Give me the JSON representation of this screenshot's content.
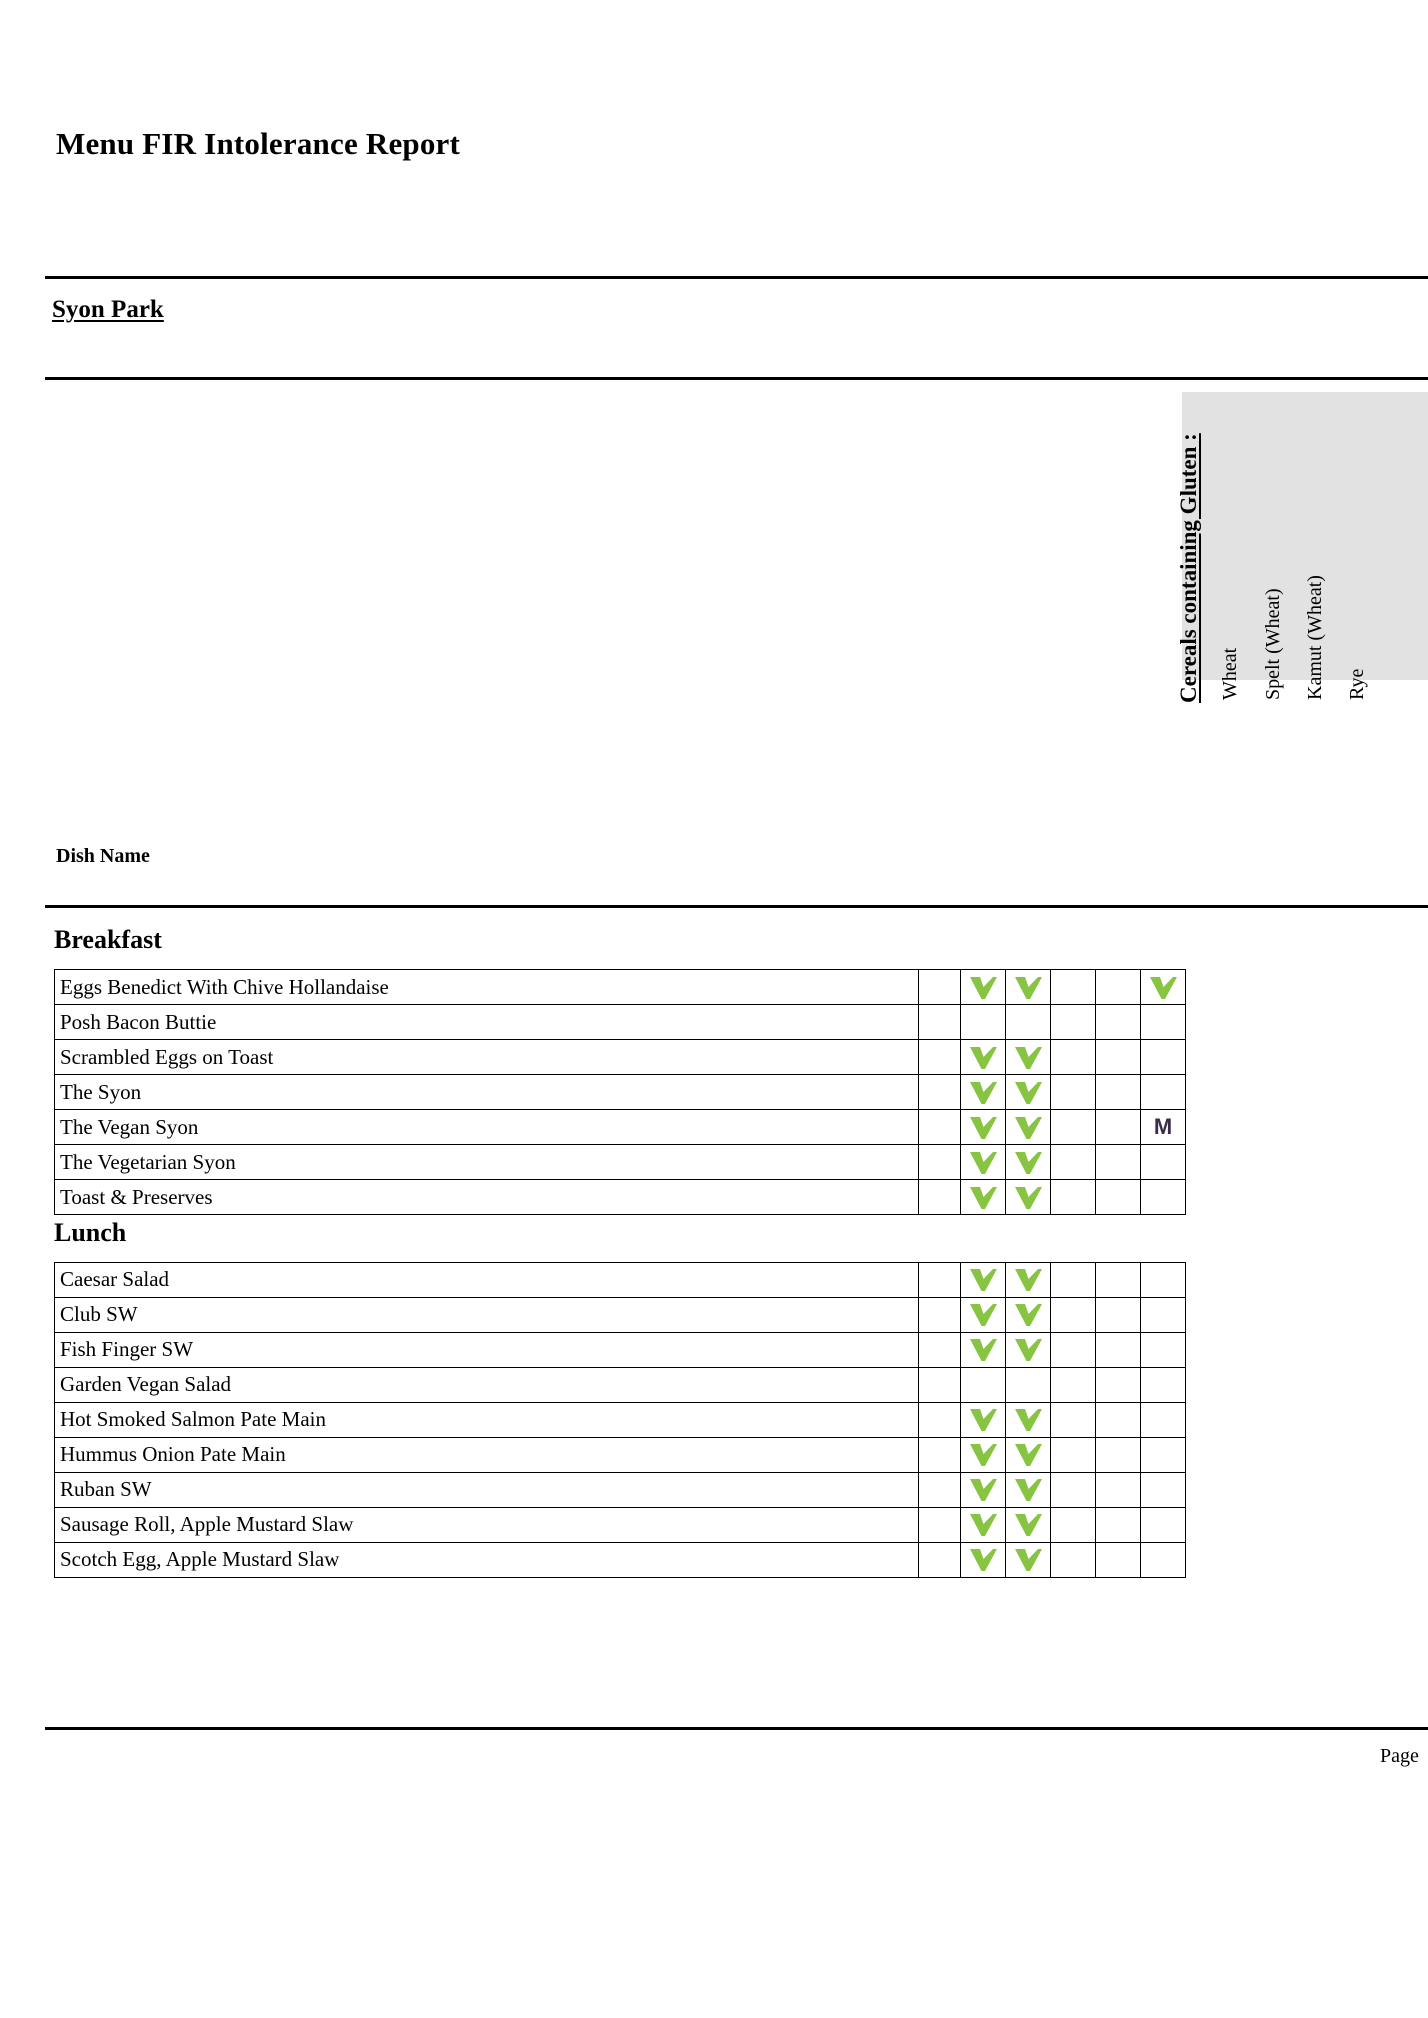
{
  "document": {
    "title": "Menu FIR Intolerance Report",
    "venue": "Syon Park",
    "dish_name_label": "Dish Name",
    "footer": "Page"
  },
  "colors": {
    "tick_green": "#86c442",
    "header_grey": "#e2e2e2",
    "rule_black": "#000000"
  },
  "columns": {
    "group_label": "Cereals containing Gluten :",
    "items": [
      {
        "label": "Wheat"
      },
      {
        "label": "Spelt (Wheat)"
      },
      {
        "label": "Kamut (Wheat)"
      },
      {
        "label": "Rye"
      }
    ]
  },
  "sections": [
    {
      "heading": "Breakfast",
      "rows": [
        {
          "name": "Eggs Benedict With Chive Hollandaise",
          "marks": [
            "tick",
            "tick",
            "",
            "",
            "tick"
          ]
        },
        {
          "name": "Posh Bacon Buttie",
          "marks": [
            "",
            "",
            "",
            "",
            ""
          ]
        },
        {
          "name": "Scrambled Eggs on Toast",
          "marks": [
            "tick",
            "tick",
            "",
            "",
            ""
          ]
        },
        {
          "name": "The Syon",
          "marks": [
            "tick",
            "tick",
            "",
            "",
            ""
          ]
        },
        {
          "name": "The Vegan Syon",
          "marks": [
            "tick",
            "tick",
            "",
            "",
            "M"
          ]
        },
        {
          "name": "The Vegetarian Syon",
          "marks": [
            "tick",
            "tick",
            "",
            "",
            ""
          ]
        },
        {
          "name": "Toast & Preserves",
          "marks": [
            "tick",
            "tick",
            "",
            "",
            ""
          ]
        }
      ]
    },
    {
      "heading": "Lunch",
      "rows": [
        {
          "name": "Caesar Salad",
          "marks": [
            "tick",
            "tick",
            "",
            "",
            ""
          ]
        },
        {
          "name": "Club SW",
          "marks": [
            "tick",
            "tick",
            "",
            "",
            ""
          ]
        },
        {
          "name": "Fish Finger SW",
          "marks": [
            "tick",
            "tick",
            "",
            "",
            ""
          ]
        },
        {
          "name": "Garden Vegan Salad",
          "marks": [
            "",
            "",
            "",
            "",
            ""
          ]
        },
        {
          "name": "Hot Smoked Salmon Pate Main",
          "marks": [
            "tick",
            "tick",
            "",
            "",
            ""
          ]
        },
        {
          "name": "Hummus Onion Pate Main",
          "marks": [
            "tick",
            "tick",
            "",
            "",
            ""
          ]
        },
        {
          "name": "Ruban SW",
          "marks": [
            "tick",
            "tick",
            "",
            "",
            ""
          ]
        },
        {
          "name": "Sausage Roll, Apple Mustard Slaw",
          "marks": [
            "tick",
            "tick",
            "",
            "",
            ""
          ]
        },
        {
          "name": "Scotch Egg, Apple Mustard Slaw",
          "marks": [
            "tick",
            "tick",
            "",
            "",
            ""
          ]
        }
      ]
    }
  ]
}
